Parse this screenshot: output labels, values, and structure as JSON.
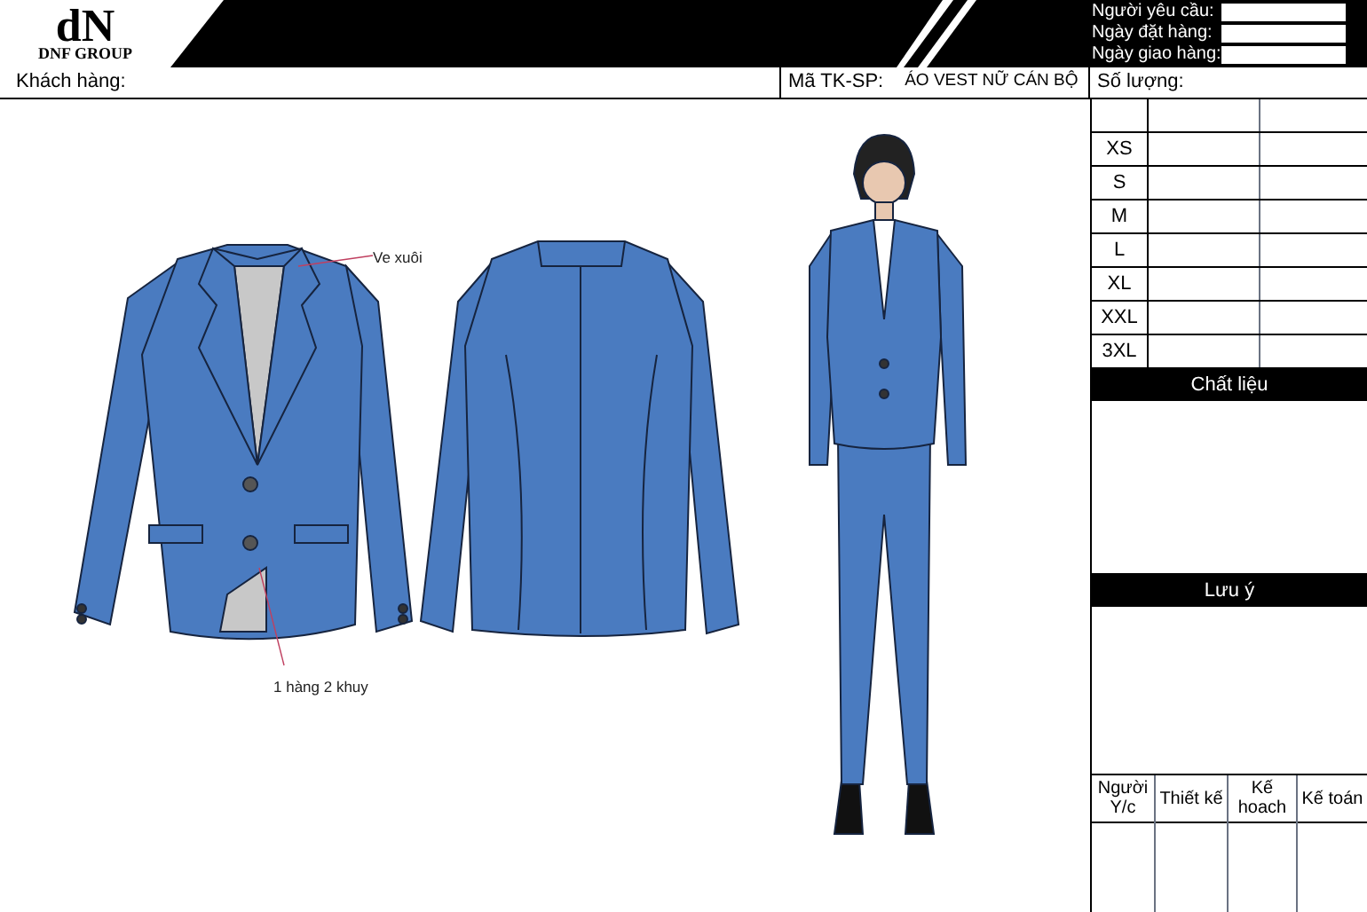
{
  "header": {
    "logo_mark": "dN",
    "logo_text": "DNF GROUP",
    "order_fields": [
      {
        "label": "Người yêu cầu:"
      },
      {
        "label": "Ngày đặt hàng:"
      },
      {
        "label": "Ngày giao hàng:"
      }
    ]
  },
  "info_row": {
    "customer_label": "Khách hàng:",
    "code_label": "Mã TK-SP:",
    "product_name": "ÁO VEST NỮ CÁN BỘ",
    "quantity_label": "Số lượng:"
  },
  "sizes": [
    "XS",
    "S",
    "M",
    "L",
    "XL",
    "XXL",
    "3XL"
  ],
  "sections": [
    {
      "title": "Chất liệu"
    },
    {
      "title": "Lưu ý"
    }
  ],
  "signoffs": [
    "Người Y/c",
    "Thiết kế",
    "Kế hoach",
    "Kế toán"
  ],
  "annotations": [
    {
      "text": "Ve xuôi"
    },
    {
      "text": "1 hàng 2 khuy"
    }
  ]
}
